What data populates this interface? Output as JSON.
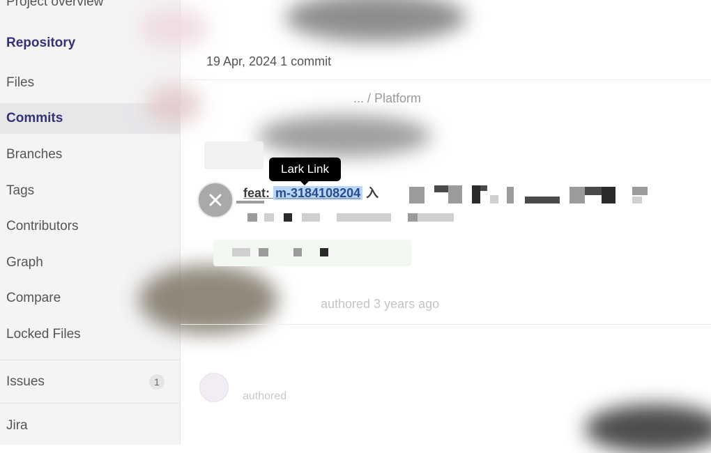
{
  "sidebar": {
    "items": [
      {
        "label": "Project overview"
      },
      {
        "label": "Repository"
      },
      {
        "label": "Files"
      },
      {
        "label": "Commits"
      },
      {
        "label": "Branches"
      },
      {
        "label": "Tags"
      },
      {
        "label": "Contributors"
      },
      {
        "label": "Graph"
      },
      {
        "label": "Compare"
      },
      {
        "label": "Locked Files"
      },
      {
        "label": "Issues",
        "badge": "1"
      },
      {
        "label": "Jira"
      }
    ],
    "active_item": "Commits",
    "section_header": "Repository"
  },
  "main": {
    "date_header": "19 Apr, 2024 1 commit",
    "project_path_fragment": "... / Platform",
    "commit": {
      "title_prefix": "feat: ",
      "commit_id": "m-3184108204",
      "title_suffix": " 入",
      "tooltip": "Lark Link"
    },
    "authored_text": "authored 3 years ago",
    "author_line": "authored"
  },
  "icons": {
    "close": "close-icon"
  },
  "colors": {
    "accent": "#333276",
    "sidebar_bg": "#f4f4f5",
    "active_bg": "#e7e7ea",
    "highlight": "#b8d6f8",
    "tooltip_bg": "#000000"
  }
}
